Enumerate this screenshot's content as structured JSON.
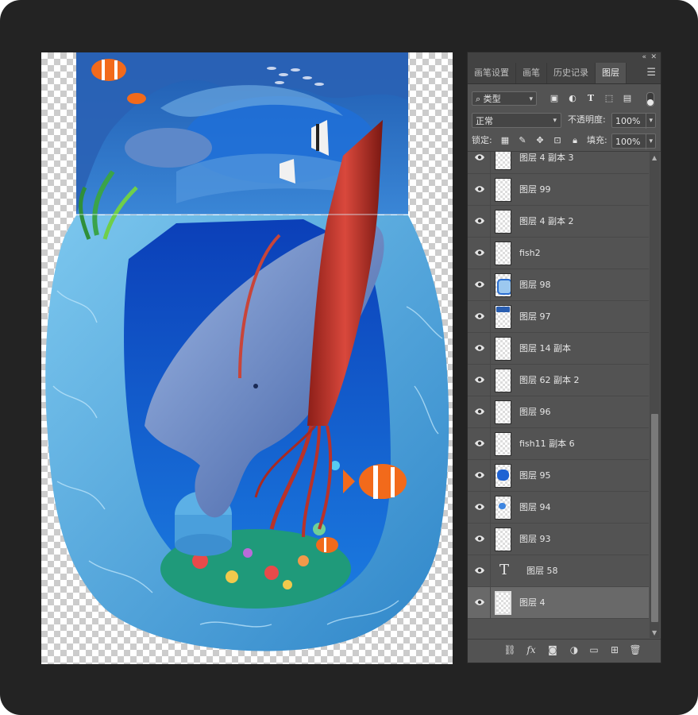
{
  "tabs": [
    {
      "label": "画笔设置"
    },
    {
      "label": "画笔"
    },
    {
      "label": "历史记录"
    },
    {
      "label": "图层"
    }
  ],
  "header": {
    "collapse_icon": "double-chevron-icon",
    "close_icon": "close-icon",
    "menu_icon": "hamburger-icon"
  },
  "filter": {
    "kind_label": "类型",
    "kind_icon": "search-icon"
  },
  "blend_mode": "正常",
  "opacity": {
    "label": "不透明度:",
    "value": "100%"
  },
  "lock": {
    "label": "锁定:"
  },
  "fill": {
    "label": "填充:",
    "value": "100%"
  },
  "layers": [
    {
      "name": "图层 4 副本 3",
      "visible": true,
      "thumb": "plain"
    },
    {
      "name": "图层 99",
      "visible": true,
      "thumb": "plain"
    },
    {
      "name": "图层 4 副本 2",
      "visible": true,
      "thumb": "plain"
    },
    {
      "name": "fish2",
      "visible": true,
      "thumb": "plain"
    },
    {
      "name": "图层 98",
      "visible": true,
      "thumb": "blue-frame"
    },
    {
      "name": "图层 97",
      "visible": true,
      "thumb": "blue-top"
    },
    {
      "name": "图层 14 副本",
      "visible": true,
      "thumb": "plain"
    },
    {
      "name": "图层 62 副本 2",
      "visible": true,
      "thumb": "plain"
    },
    {
      "name": "图层 96",
      "visible": true,
      "thumb": "plain"
    },
    {
      "name": "fish11 副本 6",
      "visible": true,
      "thumb": "plain"
    },
    {
      "name": "图层 95",
      "visible": true,
      "thumb": "blue-blob"
    },
    {
      "name": "图层 94",
      "visible": true,
      "thumb": "blue-small"
    },
    {
      "name": "图层 93",
      "visible": true,
      "thumb": "plain"
    },
    {
      "name": "图层 58",
      "visible": true,
      "thumb": "text",
      "glyph": "T"
    },
    {
      "name": "图层 4",
      "visible": true,
      "thumb": "selected",
      "selected": true
    }
  ],
  "colors": {
    "frame": "#232323",
    "panel": "#535353",
    "panel_dark": "#424242",
    "selected_row": "#696969",
    "ocean_deep": "#0a47c9",
    "ocean_light": "#5fb8e8",
    "squid": "#b8322a",
    "whale": "#6a86c4",
    "clownfish": "#f26a1b"
  }
}
